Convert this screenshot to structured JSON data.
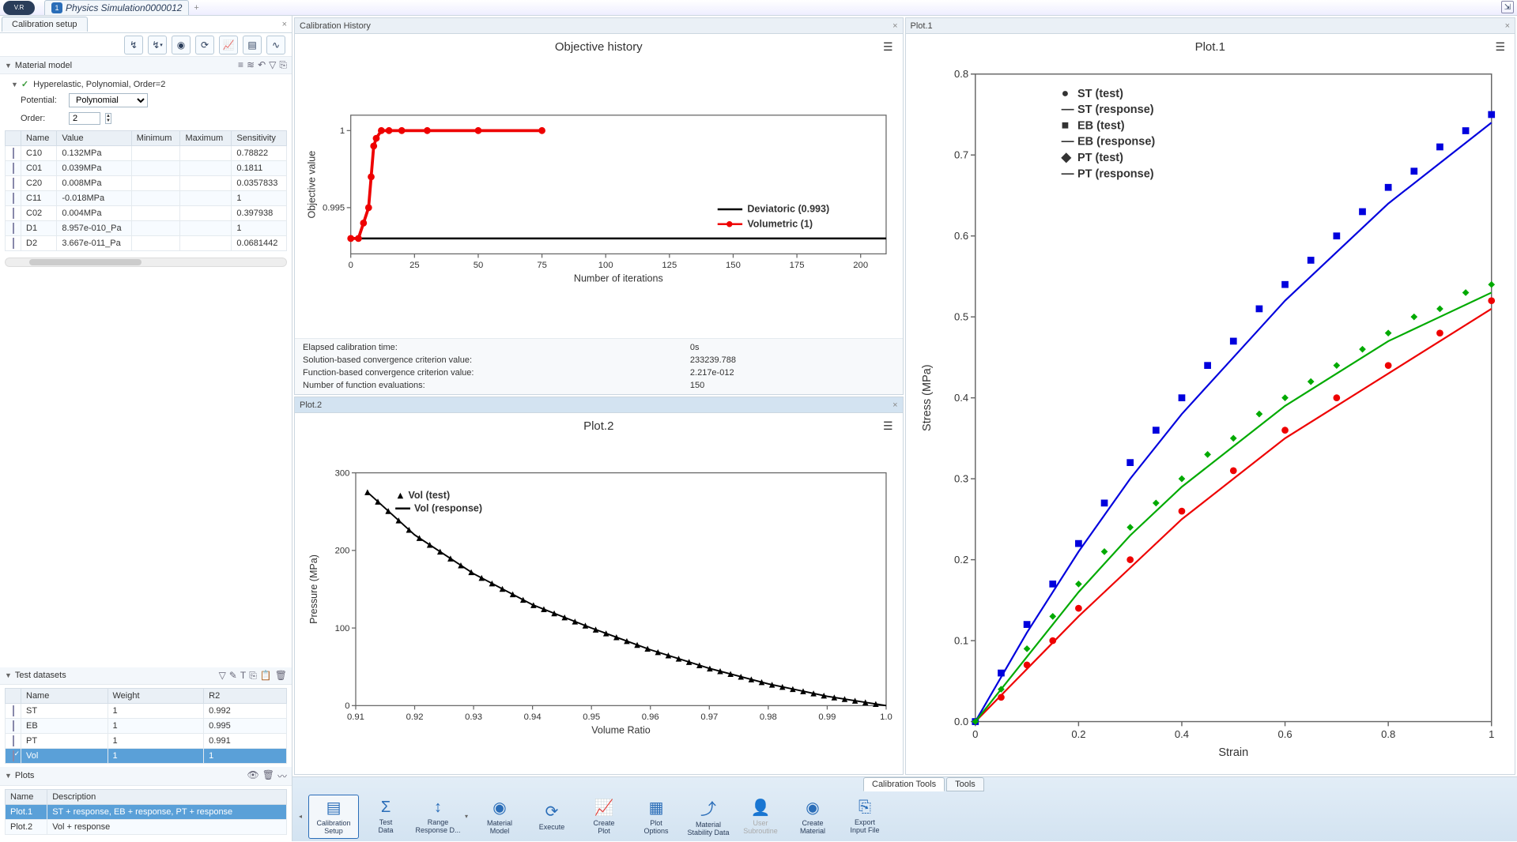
{
  "top": {
    "vr": "V.R",
    "tab_title": "Physics Simulation0000012",
    "tab_icon_text": "1"
  },
  "leftPanel": {
    "title": "Calibration setup",
    "section_material": "Material model",
    "material_tree": "Hyperelastic, Polynomial, Order=2",
    "potential_label": "Potential:",
    "potential_value": "Polynomial",
    "order_label": "Order:",
    "order_value": "2",
    "param_headers": [
      "",
      "Name",
      "Value",
      "Minimum",
      "Maximum",
      "Sensitivity"
    ],
    "params": [
      {
        "name": "C10",
        "value": "0.132MPa",
        "min": "",
        "max": "",
        "sens": "0.78822"
      },
      {
        "name": "C01",
        "value": "0.039MPa",
        "min": "",
        "max": "",
        "sens": "0.1811"
      },
      {
        "name": "C20",
        "value": "0.008MPa",
        "min": "",
        "max": "",
        "sens": "0.0357833"
      },
      {
        "name": "C11",
        "value": "-0.018MPa",
        "min": "",
        "max": "",
        "sens": "1"
      },
      {
        "name": "C02",
        "value": "0.004MPa",
        "min": "",
        "max": "",
        "sens": "0.397938"
      },
      {
        "name": "D1",
        "value": "8.957e-010_Pa",
        "min": "",
        "max": "",
        "sens": "1"
      },
      {
        "name": "D2",
        "value": "3.667e-011_Pa",
        "min": "",
        "max": "",
        "sens": "0.0681442"
      }
    ],
    "section_test": "Test datasets",
    "test_headers": [
      "",
      "Name",
      "Weight",
      "R2"
    ],
    "tests": [
      {
        "name": "ST",
        "weight": "1",
        "r2": "0.992",
        "sel": false
      },
      {
        "name": "EB",
        "weight": "1",
        "r2": "0.995",
        "sel": false
      },
      {
        "name": "PT",
        "weight": "1",
        "r2": "0.991",
        "sel": false
      },
      {
        "name": "Vol",
        "weight": "1",
        "r2": "1",
        "sel": true
      }
    ],
    "section_plots": "Plots",
    "plot_headers": [
      "Name",
      "Description"
    ],
    "plots": [
      {
        "name": "Plot.1",
        "desc": "ST + response, EB + response, PT + response",
        "sel": true
      },
      {
        "name": "Plot.2",
        "desc": "Vol + response",
        "sel": false
      }
    ]
  },
  "calHistory": {
    "title": "Calibration History",
    "chart_title": "Objective history",
    "xlabel": "Number of iterations",
    "ylabel": "Objective value",
    "legend": {
      "dev": "Deviatoric (0.993)",
      "vol": "Volumetric (1)"
    },
    "info": [
      {
        "k": "Elapsed calibration time:",
        "v": "0s"
      },
      {
        "k": "Solution-based convergence criterion value:",
        "v": "233239.788"
      },
      {
        "k": "Function-based convergence criterion value:",
        "v": "2.217e-012"
      },
      {
        "k": "Number of function evaluations:",
        "v": "150"
      }
    ]
  },
  "plot2": {
    "title": "Plot.2",
    "chart_title": "Plot.2",
    "xlabel": "Volume Ratio",
    "ylabel": "Pressure (MPa)",
    "legend": {
      "t": "Vol (test)",
      "r": "Vol (response)"
    }
  },
  "plot1": {
    "title": "Plot.1",
    "chart_title": "Plot.1",
    "xlabel": "Strain",
    "ylabel": "Stress (MPa)",
    "legend": [
      "ST (test)",
      "ST (response)",
      "EB (test)",
      "EB (response)",
      "PT (test)",
      "PT (response)"
    ]
  },
  "bottomTabs": {
    "cal": "Calibration Tools",
    "tools": "Tools"
  },
  "buttons": {
    "calsetup": "Calibration\nSetup",
    "testdata": "Test\nData",
    "rangeresp": "Range\nResponse D...",
    "matmodel": "Material\nModel",
    "execute": "Execute",
    "createplot": "Create\nPlot",
    "plotopt": "Plot\nOptions",
    "matstab": "Material\nStability Data",
    "usersub": "User\nSubroutine",
    "creatematerial": "Create\nMaterial",
    "export": "Export\nInput File"
  },
  "chart_data": [
    {
      "id": "objective_history",
      "type": "line",
      "title": "Objective history",
      "xlabel": "Number of iterations",
      "ylabel": "Objective value",
      "xlim": [
        0,
        210
      ],
      "ylim": [
        0.992,
        1.001
      ],
      "series": [
        {
          "name": "Deviatoric (0.993)",
          "color": "#000",
          "style": "line",
          "x": [
            0,
            210
          ],
          "y": [
            0.993,
            0.993
          ]
        },
        {
          "name": "Volumetric (1)",
          "color": "#e00",
          "style": "line-marker",
          "x": [
            0,
            3,
            5,
            7,
            8,
            9,
            10,
            12,
            15,
            20,
            30,
            50,
            75
          ],
          "y": [
            0.993,
            0.993,
            0.994,
            0.995,
            0.997,
            0.999,
            0.9995,
            1,
            1,
            1,
            1,
            1,
            1
          ]
        }
      ]
    },
    {
      "id": "plot2_volumetric",
      "type": "line",
      "title": "Plot.2",
      "xlabel": "Volume Ratio",
      "ylabel": "Pressure (MPa)",
      "xlim": [
        0.91,
        1.0
      ],
      "ylim": [
        0,
        300
      ],
      "series": [
        {
          "name": "Vol (test)",
          "style": "scatter",
          "marker": "triangle",
          "color": "#000",
          "x": [
            0.912,
            0.92,
            0.93,
            0.94,
            0.95,
            0.96,
            0.97,
            0.98,
            0.99,
            1.0
          ],
          "y": [
            275,
            220,
            170,
            130,
            100,
            72,
            48,
            28,
            12,
            0
          ]
        },
        {
          "name": "Vol (response)",
          "style": "line",
          "color": "#000",
          "x": [
            0.912,
            0.92,
            0.93,
            0.94,
            0.95,
            0.96,
            0.97,
            0.98,
            0.99,
            1.0
          ],
          "y": [
            275,
            220,
            170,
            130,
            100,
            72,
            48,
            28,
            12,
            0
          ]
        }
      ]
    },
    {
      "id": "plot1_stress_strain",
      "type": "line",
      "title": "Plot.1",
      "xlabel": "Strain",
      "ylabel": "Stress (MPa)",
      "xlim": [
        0,
        1.0
      ],
      "ylim": [
        0,
        0.8
      ],
      "series": [
        {
          "name": "ST (test)",
          "style": "scatter",
          "marker": "circle",
          "color": "#e00",
          "x": [
            0,
            0.05,
            0.1,
            0.15,
            0.2,
            0.3,
            0.4,
            0.5,
            0.6,
            0.7,
            0.8,
            0.9,
            1.0
          ],
          "y": [
            0,
            0.03,
            0.07,
            0.1,
            0.14,
            0.2,
            0.26,
            0.31,
            0.36,
            0.4,
            0.44,
            0.48,
            0.52
          ]
        },
        {
          "name": "ST (response)",
          "style": "line",
          "color": "#e00",
          "x": [
            0,
            0.1,
            0.2,
            0.3,
            0.4,
            0.5,
            0.6,
            0.7,
            0.8,
            0.9,
            1.0
          ],
          "y": [
            0,
            0.065,
            0.13,
            0.19,
            0.25,
            0.3,
            0.35,
            0.39,
            0.43,
            0.47,
            0.51
          ]
        },
        {
          "name": "EB (test)",
          "style": "scatter",
          "marker": "square",
          "color": "#00d",
          "x": [
            0,
            0.05,
            0.1,
            0.15,
            0.2,
            0.25,
            0.3,
            0.35,
            0.4,
            0.45,
            0.5,
            0.55,
            0.6,
            0.65,
            0.7,
            0.75,
            0.8,
            0.85,
            0.9,
            0.95,
            1.0
          ],
          "y": [
            0,
            0.06,
            0.12,
            0.17,
            0.22,
            0.27,
            0.32,
            0.36,
            0.4,
            0.44,
            0.47,
            0.51,
            0.54,
            0.57,
            0.6,
            0.63,
            0.66,
            0.68,
            0.71,
            0.73,
            0.75
          ]
        },
        {
          "name": "EB (response)",
          "style": "line",
          "color": "#00d",
          "x": [
            0,
            0.1,
            0.2,
            0.3,
            0.4,
            0.5,
            0.6,
            0.7,
            0.8,
            0.9,
            1.0
          ],
          "y": [
            0,
            0.11,
            0.21,
            0.3,
            0.38,
            0.45,
            0.52,
            0.58,
            0.64,
            0.69,
            0.74
          ]
        },
        {
          "name": "PT (test)",
          "style": "scatter",
          "marker": "diamond",
          "color": "#0a0",
          "x": [
            0,
            0.05,
            0.1,
            0.15,
            0.2,
            0.25,
            0.3,
            0.35,
            0.4,
            0.45,
            0.5,
            0.55,
            0.6,
            0.65,
            0.7,
            0.75,
            0.8,
            0.85,
            0.9,
            0.95,
            1.0
          ],
          "y": [
            0,
            0.04,
            0.09,
            0.13,
            0.17,
            0.21,
            0.24,
            0.27,
            0.3,
            0.33,
            0.35,
            0.38,
            0.4,
            0.42,
            0.44,
            0.46,
            0.48,
            0.5,
            0.51,
            0.53,
            0.54
          ]
        },
        {
          "name": "PT (response)",
          "style": "line",
          "color": "#0a0",
          "x": [
            0,
            0.1,
            0.2,
            0.3,
            0.4,
            0.5,
            0.6,
            0.7,
            0.8,
            0.9,
            1.0
          ],
          "y": [
            0,
            0.08,
            0.16,
            0.23,
            0.29,
            0.34,
            0.39,
            0.43,
            0.47,
            0.5,
            0.53
          ]
        }
      ]
    }
  ]
}
